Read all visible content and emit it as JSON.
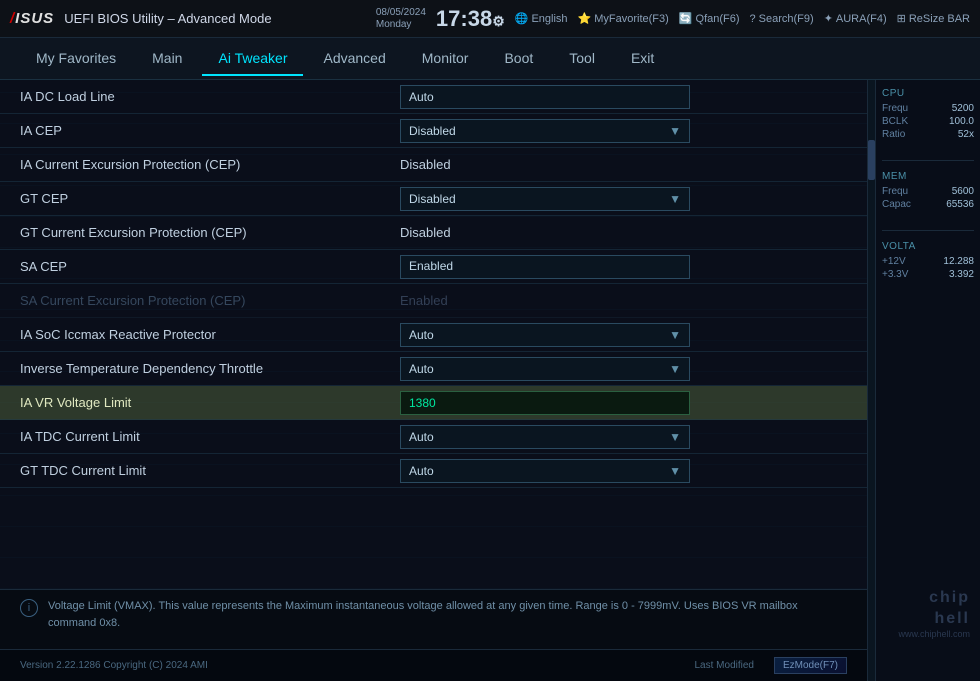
{
  "app": {
    "brand": "ASUS",
    "title": "UEFI BIOS Utility – Advanced Mode",
    "date": "08/05/2024",
    "day": "Monday",
    "time": "17:38",
    "gear_symbol": "⚙"
  },
  "topicons": [
    {
      "label": "English",
      "icon": "🌐"
    },
    {
      "label": "MyFavorite(F3)",
      "icon": "⭐"
    },
    {
      "label": "Qfan(F6)",
      "icon": "🔄"
    },
    {
      "label": "Search(F9)",
      "icon": "?"
    },
    {
      "label": "AURA(F4)",
      "icon": "✦"
    },
    {
      "label": "ReSize BAR",
      "icon": "⊞"
    }
  ],
  "nav": {
    "items": [
      {
        "label": "My Favorites",
        "active": false
      },
      {
        "label": "Main",
        "active": false
      },
      {
        "label": "Ai Tweaker",
        "active": true
      },
      {
        "label": "Advanced",
        "active": false
      },
      {
        "label": "Monitor",
        "active": false
      },
      {
        "label": "Boot",
        "active": false
      },
      {
        "label": "Tool",
        "active": false
      },
      {
        "label": "Exit",
        "active": false
      }
    ]
  },
  "settings": [
    {
      "label": "IA DC Load Line",
      "value_type": "text",
      "value": "Auto",
      "highlighted": false,
      "dimmed": false
    },
    {
      "label": "IA CEP",
      "value_type": "dropdown",
      "value": "Disabled",
      "highlighted": false,
      "dimmed": false
    },
    {
      "label": "IA Current Excursion Protection (CEP)",
      "value_type": "plain",
      "value": "Disabled",
      "highlighted": false,
      "dimmed": false
    },
    {
      "label": "GT CEP",
      "value_type": "dropdown",
      "value": "Disabled",
      "highlighted": false,
      "dimmed": false
    },
    {
      "label": "GT Current Excursion Protection (CEP)",
      "value_type": "plain",
      "value": "Disabled",
      "highlighted": false,
      "dimmed": false
    },
    {
      "label": "SA CEP",
      "value_type": "enabled_box",
      "value": "Enabled",
      "highlighted": false,
      "dimmed": false
    },
    {
      "label": "SA Current Excursion Protection (CEP)",
      "value_type": "plain",
      "value": "Enabled",
      "highlighted": false,
      "dimmed": true
    },
    {
      "label": "IA SoC Iccmax Reactive Protector",
      "value_type": "dropdown",
      "value": "Auto",
      "highlighted": false,
      "dimmed": false
    },
    {
      "label": "Inverse Temperature Dependency Throttle",
      "value_type": "dropdown",
      "value": "Auto",
      "highlighted": false,
      "dimmed": false
    },
    {
      "label": "IA VR Voltage Limit",
      "value_type": "input",
      "value": "1380",
      "highlighted": true,
      "dimmed": false
    },
    {
      "label": "IA TDC Current Limit",
      "value_type": "dropdown",
      "value": "Auto",
      "highlighted": false,
      "dimmed": false
    },
    {
      "label": "GT TDC Current Limit",
      "value_type": "dropdown",
      "value": "Auto",
      "highlighted": false,
      "dimmed": false
    }
  ],
  "info_text": "Voltage Limit (VMAX). This value represents the Maximum instantaneous voltage allowed at any given time. Range is 0 - 7999mV. Uses BIOS VR mailbox command 0x8.",
  "sidebar": {
    "cpu_title": "CPU",
    "cpu_rows": [
      {
        "label": "Frequ",
        "value": "5200"
      },
      {
        "label": "BCLK",
        "value": "100.0"
      },
      {
        "label": "Ratio",
        "value": "52x"
      }
    ],
    "mem_title": "Mem",
    "mem_rows": [
      {
        "label": "Frequ",
        "value": "5600"
      },
      {
        "label": "Capac",
        "value": "65536"
      }
    ],
    "volt_title": "Volta",
    "volt_rows": [
      {
        "label": "+12V",
        "value": "12.288"
      },
      {
        "label": "+3.3V",
        "value": "3.392"
      }
    ]
  },
  "bottom": {
    "version": "Version 2.22.1286 Copyright (C) 2024 AMI",
    "last_modified": "Last Modified",
    "ezmode": "EzMode(F7)",
    "watermark": "www.chiphell.com"
  }
}
